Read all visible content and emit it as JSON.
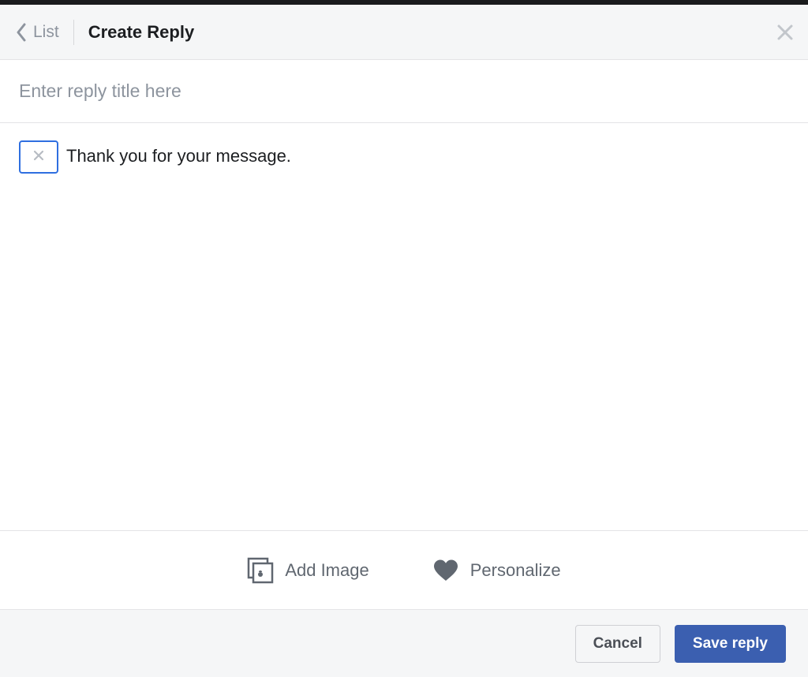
{
  "header": {
    "back_label": "List",
    "title": "Create Reply"
  },
  "title_input": {
    "placeholder": "Enter reply title here",
    "value": ""
  },
  "editor": {
    "body_text": "Thank you for your message."
  },
  "toolbar": {
    "add_image_label": "Add Image",
    "personalize_label": "Personalize"
  },
  "footer": {
    "cancel_label": "Cancel",
    "save_label": "Save reply"
  },
  "colors": {
    "accent": "#3b5fb0",
    "chip_border": "#2f6fe0",
    "muted": "#8d949e",
    "border": "#e4e4e6",
    "panel": "#f5f6f7"
  }
}
